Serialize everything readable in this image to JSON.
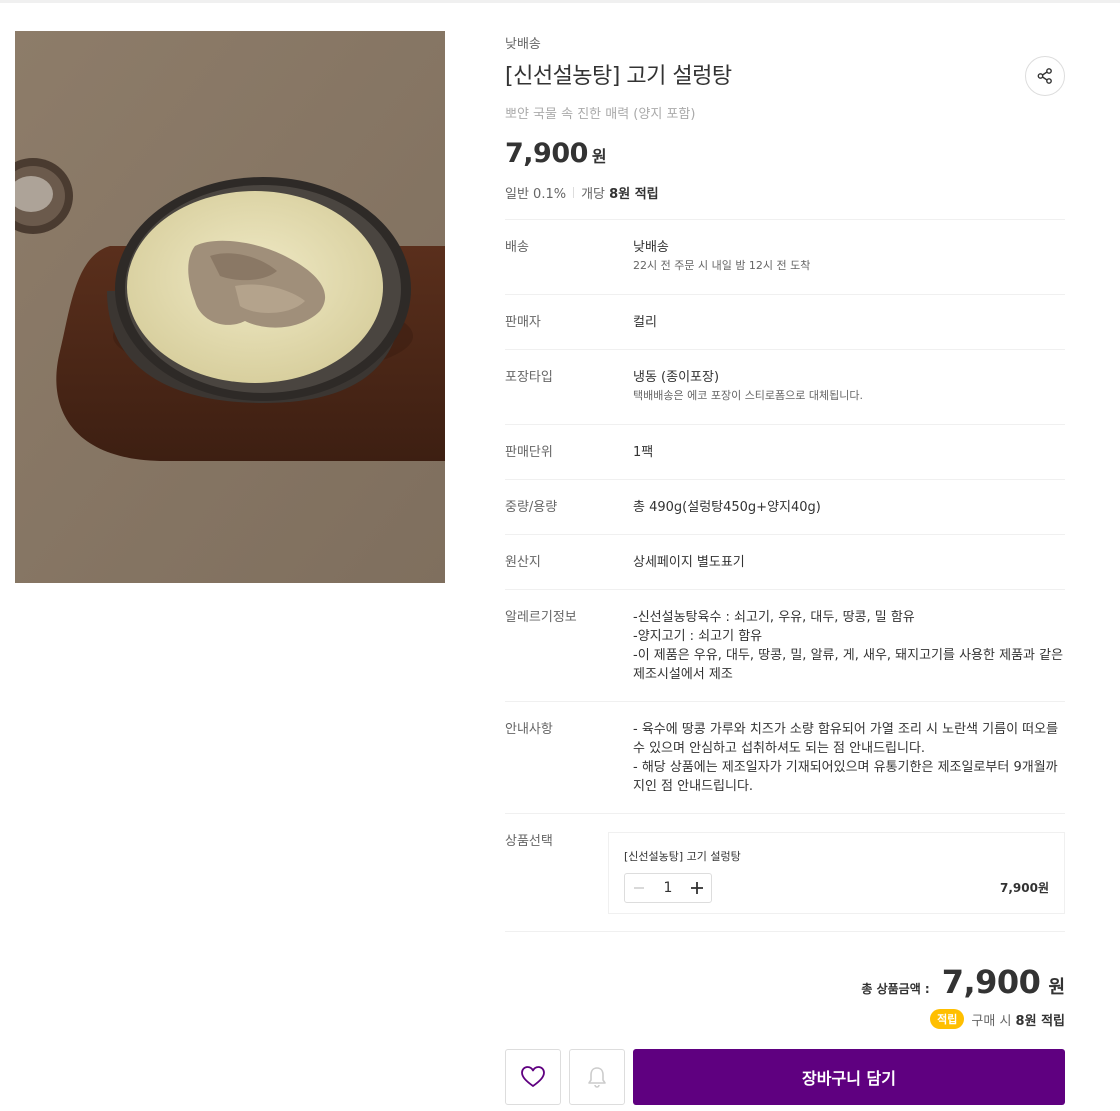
{
  "product": {
    "delivery_type": "낮배송",
    "title": "[신선설농탕] 고기 설렁탕",
    "subtitle": "뽀얀 국물 속 진한 매력 (양지 포함)",
    "price": "7,900",
    "price_unit": "원",
    "points_grade": "일반 0.1%",
    "points_per_unit_prefix": "개당",
    "points_per_unit_amount": "8원 적립"
  },
  "details": [
    {
      "label": "배송",
      "value": "낮배송",
      "sub": "22시 전 주문 시 내일 밤 12시 전 도착"
    },
    {
      "label": "판매자",
      "value": "컬리"
    },
    {
      "label": "포장타입",
      "value": "냉동 (종이포장)",
      "sub": "택배배송은 에코 포장이 스티로폼으로 대체됩니다."
    },
    {
      "label": "판매단위",
      "value": "1팩"
    },
    {
      "label": "중량/용량",
      "value": "총 490g(설렁탕450g+양지40g)"
    },
    {
      "label": "원산지",
      "value": "상세페이지 별도표기"
    },
    {
      "label": "알레르기정보",
      "lines": [
        "-신선설농탕육수 : 쇠고기, 우유, 대두, 땅콩, 밀 함유",
        "-양지고기 : 쇠고기 함유",
        "-이 제품은 우유, 대두, 땅콩, 밀, 알류, 게, 새우, 돼지고기를 사용한 제품과 같은",
        "제조시설에서 제조"
      ]
    },
    {
      "label": "안내사항",
      "lines": [
        "- 육수에 땅콩 가루와 치즈가 소량 함유되어 가열 조리 시 노란색 기름이 떠오를",
        "수 있으며 안심하고 섭취하셔도 되는 점 안내드립니다.",
        "- 해당 상품에는 제조일자가 기재되어있으며 유통기한은 제조일로부터 9개월까",
        "지인 점 안내드립니다."
      ]
    }
  ],
  "option": {
    "label": "상품선택",
    "name": "[신선설농탕] 고기 설렁탕",
    "quantity": "1",
    "price": "7,900원"
  },
  "total": {
    "label": "총 상품금액 :",
    "amount": "7,900",
    "unit": "원",
    "badge": "적립",
    "earn_prefix": "구매 시",
    "earn_amount": "8원 적립"
  },
  "actions": {
    "cart_label": "장바구니 담기"
  },
  "icons": {
    "share": "share-icon",
    "heart": "heart-icon",
    "bell": "bell-icon",
    "minus": "minus-icon",
    "plus": "plus-icon"
  },
  "colors": {
    "brand": "#5f0080",
    "badge": "#ffbf00"
  }
}
